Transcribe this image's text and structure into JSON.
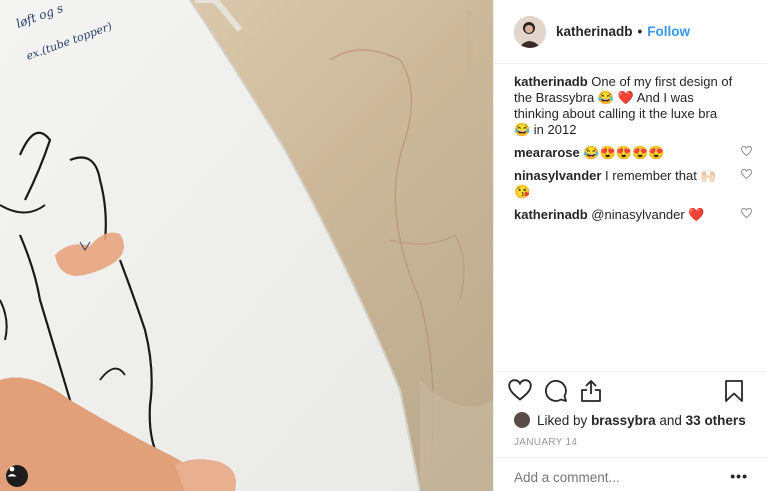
{
  "post": {
    "username": "katherinadb",
    "dot": "•",
    "follow_label": "Follow"
  },
  "comments": [
    {
      "user": "katherinadb",
      "text": " One of my first design of the Brassybra 😂 ❤️ And I was thinking about calling it the luxe bra 😂 in 2012"
    },
    {
      "user": "meararose",
      "text": " 😂😍😍😍😍"
    },
    {
      "user": "ninasylvander",
      "text": " I remember that 🙌🏻 😘"
    },
    {
      "user": "katherinadb",
      "text": " @ninasylvander ❤️"
    }
  ],
  "likes": {
    "prefix": "Liked by ",
    "user": "brassybra",
    "middle": " and ",
    "others": "33 others"
  },
  "date": "JANUARY 14",
  "add_comment_placeholder": "Add a comment...",
  "more_label": "•••",
  "sketch_note": [
    "løft og s",
    "ex.(tube topper)"
  ],
  "icons": {
    "like": "heart-icon",
    "comment": "comment-icon",
    "share": "share-icon",
    "save": "bookmark-icon",
    "tag": "user-tag-icon"
  },
  "colors": {
    "link": "#3897f0",
    "text": "#262626",
    "muted": "#999999",
    "skin_swatch": "#e8a47e"
  }
}
